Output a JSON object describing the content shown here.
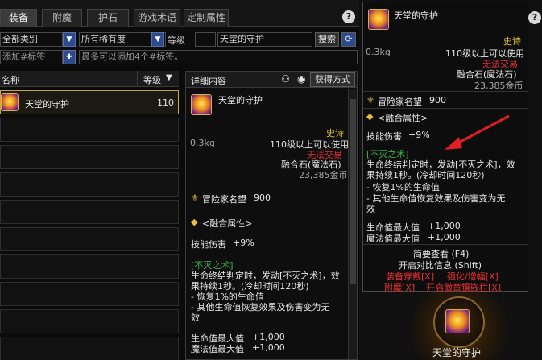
{
  "tabs": [
    {
      "label": "装备"
    },
    {
      "label": "附魔"
    },
    {
      "label": "护石"
    },
    {
      "label": "游戏术语"
    },
    {
      "label": "定制属性"
    }
  ],
  "help_glyph": "?",
  "filters": {
    "category": "全部类别",
    "rarity": "所有稀有度",
    "level_label": "等级",
    "search_value": "天堂的守护",
    "search_button": "搜索",
    "tag_placeholder": "添加#标签",
    "tag_hint": "最多可以添加4个#标签。"
  },
  "list": {
    "col_name": "名称",
    "col_level": "等级",
    "items": [
      {
        "name": "天堂的守护",
        "level": "110"
      }
    ]
  },
  "detail": {
    "header": "详细内容",
    "how_to_get": "获得方式",
    "item_name": "天堂的守护",
    "rarity": "史诗",
    "weight": "0.3kg",
    "level_req": "110级以上可以使用",
    "trade": "无法交易",
    "type": "融合石(魔法石)",
    "price": "23,385金币",
    "fame_label": "冒险家名望",
    "fame_value": "900",
    "fusion_title": "<融合属性>",
    "skill_dmg_label": "技能伤害",
    "skill_dmg_value": "+9%",
    "set_name": "[不灭之术]",
    "set_desc_1": "生命终结判定时，发动[不灭之术]，效",
    "set_desc_2": "果持续1秒。(冷却时间120秒)",
    "set_desc_3": "- 恢复1%的生命值",
    "set_desc_4": "- 其他生命值恢复效果及伤害变为无",
    "set_desc_5": "效",
    "hp_label": "生命值最大值",
    "hp_value": "+1,000",
    "mp_label": "魔法值最大值",
    "mp_value": "+1,000"
  },
  "tooltip": {
    "item_name": "天堂的守护",
    "rarity": "史诗",
    "weight": "0.3kg",
    "level_req": "110级以上可以使用",
    "trade": "无法交易",
    "type": "融合石(魔法石)",
    "price": "23,385金币",
    "fame_label": "冒险家名望",
    "fame_value": "900",
    "fusion_title": "<融合属性>",
    "skill_dmg_label": "技能伤害",
    "skill_dmg_value": "+9%",
    "set_name": "[不灭之术]",
    "set_desc_1": "生命终结判定时，发动[不灭之术]，效",
    "set_desc_2": "果持续1秒。(冷却时间120秒)",
    "set_desc_3": "- 恢复1%的生命值",
    "set_desc_4": "- 其他生命值恢复效果及伤害变为无",
    "set_desc_5": "效",
    "hp_label": "生命值最大值",
    "hp_value": "+1,000",
    "mp_label": "魔法值最大值",
    "mp_value": "+1,000",
    "brief": "简要查看 (F4)",
    "compare": "开启对比信息 (Shift)",
    "wear": "装备穿戴[X]",
    "enhance": "强化/增幅[X]",
    "enchant": "附魔[X]",
    "emblem": "开启徽章镶嵌栏[X]"
  },
  "slot_label": "天堂的守护",
  "colors": {
    "epic": "#e8c040",
    "untradeable": "#e83030",
    "set_green": "#3cb04a",
    "link_red": "#e83030",
    "select_blue": "#2d4a8a"
  }
}
